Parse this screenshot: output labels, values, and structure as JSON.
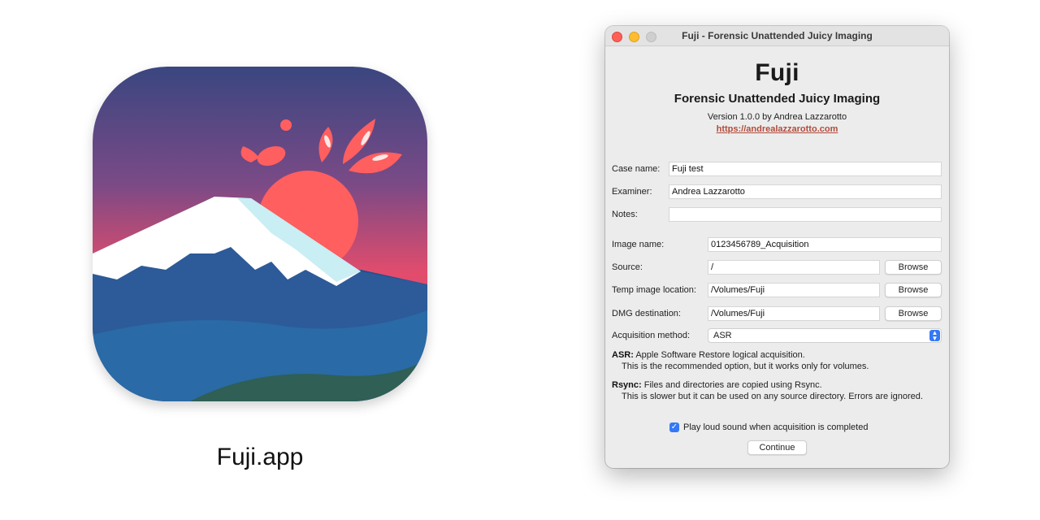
{
  "icon_caption": "Fuji.app",
  "window": {
    "title": "Fuji - Forensic Unattended Juicy Imaging",
    "app_name": "Fuji",
    "subtitle": "Forensic Unattended Juicy Imaging",
    "version": "Version 1.0.0 by Andrea Lazzarotto",
    "website": "https://andrealazzarotto.com"
  },
  "form": {
    "case_name": {
      "label": "Case name:",
      "value": "Fuji test"
    },
    "examiner": {
      "label": "Examiner:",
      "value": "Andrea Lazzarotto"
    },
    "notes": {
      "label": "Notes:",
      "value": ""
    },
    "image_name": {
      "label": "Image name:",
      "value": "0123456789_Acquisition"
    },
    "source": {
      "label": "Source:",
      "value": "/",
      "button": "Browse"
    },
    "temp_location": {
      "label": "Temp image location:",
      "value": "/Volumes/Fuji",
      "button": "Browse"
    },
    "dmg_destination": {
      "label": "DMG destination:",
      "value": "/Volumes/Fuji",
      "button": "Browse"
    },
    "acquisition_method": {
      "label": "Acquisition method:",
      "value": "ASR"
    }
  },
  "descriptions": {
    "asr_title": "ASR:",
    "asr_line1": "Apple Software Restore logical acquisition.",
    "asr_line2": "This is the recommended option, but it works only for volumes.",
    "rsync_title": "Rsync:",
    "rsync_line1": "Files and directories are copied using Rsync.",
    "rsync_line2": "This is slower but it can be used on any source directory. Errors are ignored."
  },
  "sound_checkbox": {
    "label": "Play loud sound when acquisition is completed",
    "checked": true
  },
  "continue_label": "Continue",
  "colors": {
    "sky_top": "#3b4680",
    "sky_bottom": "#e9506a",
    "sun": "#ff5f5f",
    "snow": "#ffffff",
    "mountain": "#2d5a98"
  }
}
